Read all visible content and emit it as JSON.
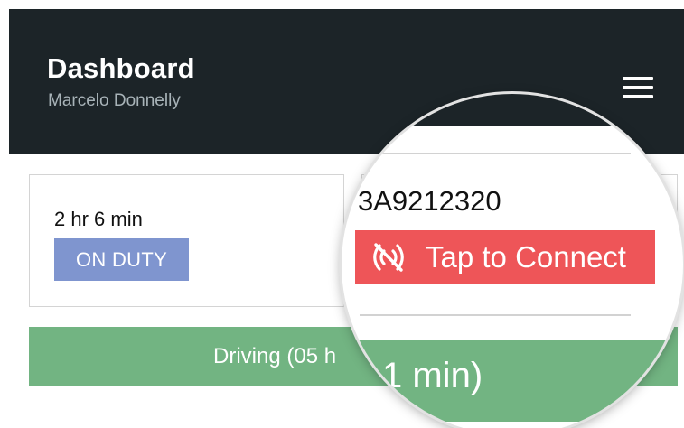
{
  "header": {
    "title": "Dashboard",
    "subtitle": "Marcelo Donnelly",
    "menu_icon": "hamburger-menu-icon"
  },
  "duty_card": {
    "time": "2 hr 6 min",
    "status": "ON DUTY"
  },
  "vehicle_card": {
    "vehicle_id": "3A9212320",
    "connect_label": "Tap to Connect",
    "connect_icon": "no-signal-icon"
  },
  "driving_bar": {
    "label": "Driving (05 h"
  },
  "magnifier": {
    "driving_fragment": "1 min)"
  },
  "colors": {
    "header_bg": "#1c2428",
    "duty_badge": "#7f95cf",
    "connect_button": "#ee5558",
    "driving_bar": "#72b482"
  }
}
